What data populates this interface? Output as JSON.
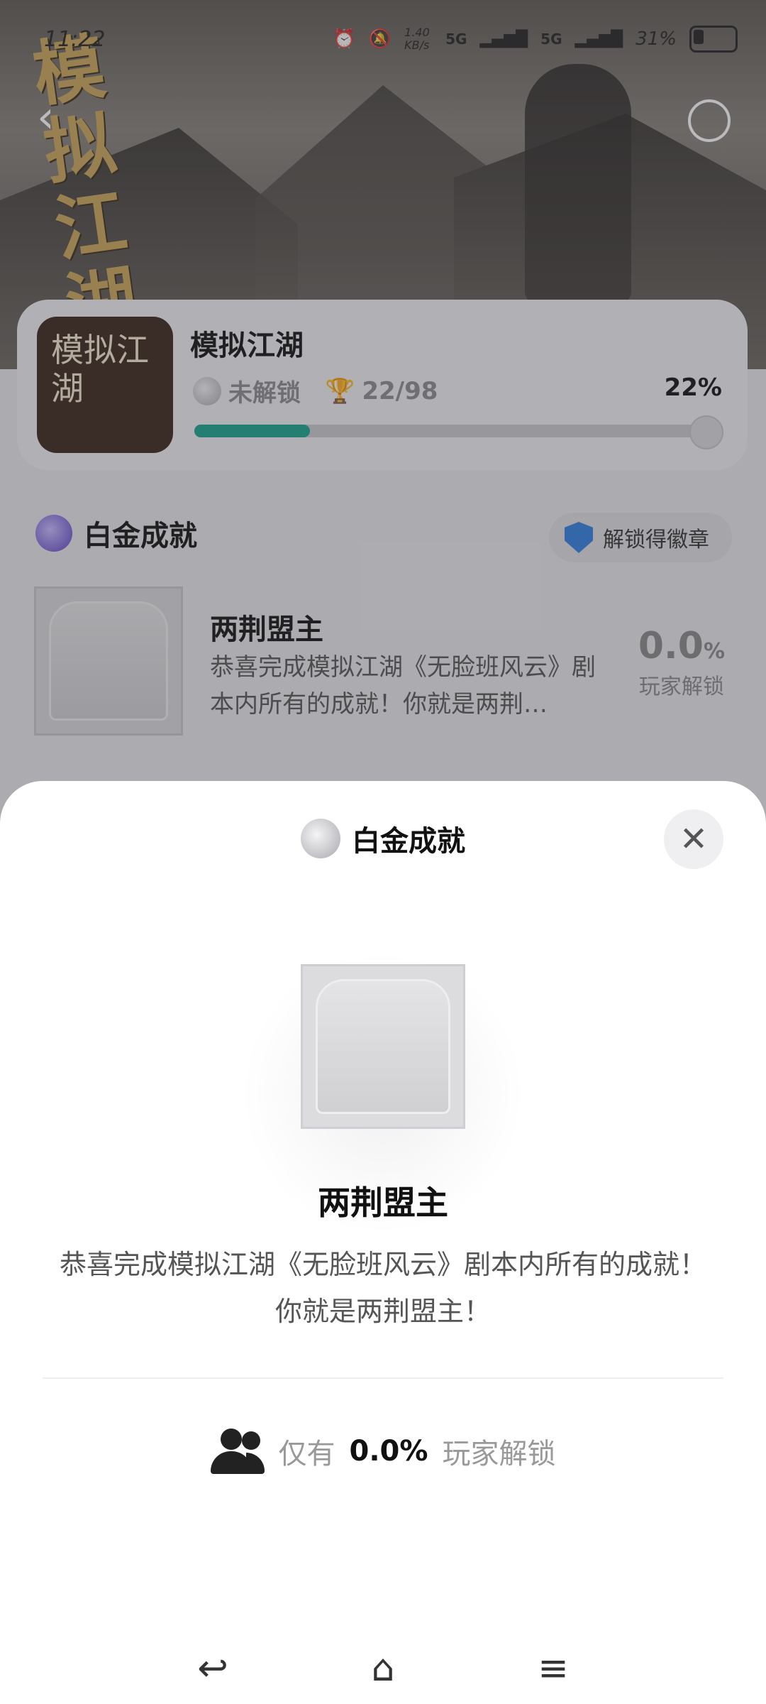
{
  "status_bar": {
    "time": "11:22",
    "net_speed": "1.40 KB/s",
    "signal1": "5G",
    "signal2": "5G",
    "battery": "31%"
  },
  "hero": {
    "logo_text": "模拟江湖"
  },
  "game": {
    "title": "模拟江湖",
    "cover_text": "模拟江湖",
    "lock_status": "未解锁",
    "trophy_count": "22/98",
    "percent_text": "22%",
    "progress": 0.22
  },
  "section": {
    "title": "白金成就",
    "badge_label": "解锁得徽章"
  },
  "achievement": {
    "name": "两荆盟主",
    "desc": "恭喜完成模拟江湖《无脸班风云》剧本内所有的成就！你就是两荆…",
    "pct_num": "0.0",
    "pct_unit": "%",
    "pct_label": "玩家解锁"
  },
  "sheet": {
    "title": "白金成就",
    "close_symbol": "✕",
    "name": "两荆盟主",
    "desc": "恭喜完成模拟江湖《无脸班风云》剧本内所有的成就！你就是两荆盟主！",
    "unlock_prefix": "仅有",
    "unlock_value": "0.0%",
    "unlock_suffix": "玩家解锁"
  },
  "nav": {
    "back": "↩",
    "home": "⌂",
    "menu": "≡"
  }
}
